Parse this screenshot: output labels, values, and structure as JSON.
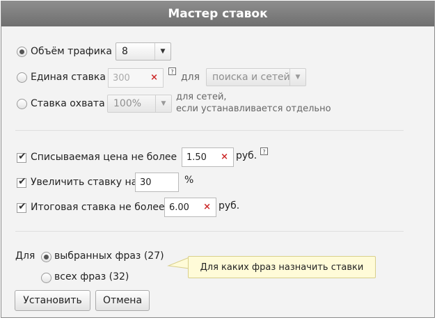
{
  "title": "Мастер ставок",
  "bid_mode": {
    "traffic_volume": {
      "label": "Объём трафика",
      "value": "8",
      "selected": true
    },
    "single_bid": {
      "label": "Единая ставка",
      "placeholder": "300",
      "for_label": "для",
      "scope_value": "поиска и сетей",
      "selected": false
    },
    "coverage_bid": {
      "label": "Ставка охвата",
      "value": "100%",
      "note_line1": "для сетей,",
      "note_line2": "если устанавливается отдельно",
      "selected": false
    }
  },
  "limits": {
    "max_price": {
      "label": "Списываемая цена не более",
      "value": "1.50",
      "unit": "руб.",
      "checked": true
    },
    "increase": {
      "label": "Увеличить ставку на",
      "value": "30",
      "unit": "%",
      "checked": true
    },
    "total_max": {
      "label": "Итоговая ставка не более",
      "value": "6.00",
      "unit": "руб.",
      "checked": true
    }
  },
  "apply_to": {
    "label": "Для",
    "selected_phrases": {
      "label": "выбранных фраз (27)",
      "selected": true
    },
    "all_phrases": {
      "label": "всех фраз (32)",
      "selected": false
    },
    "tooltip": "Для каких фраз назначить ставки"
  },
  "buttons": {
    "apply": "Установить",
    "cancel": "Отмена"
  },
  "icons": {
    "help": "?",
    "clear": "×",
    "dropdown": "▼",
    "check": "✔"
  }
}
